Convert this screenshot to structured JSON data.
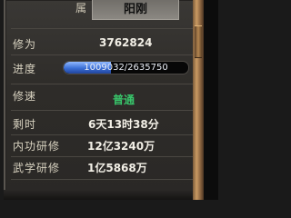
{
  "attribute": {
    "label": "属",
    "value": "阳刚"
  },
  "cultivation": {
    "label": "修为",
    "value": "3762824"
  },
  "progress": {
    "label": "进度",
    "text": "1009032/2635750",
    "current": 1009032,
    "max": 2635750
  },
  "speed": {
    "label": "修速",
    "value": "普通",
    "color": "#38c46a"
  },
  "remaining": {
    "label": "剩时",
    "value": "6天13时38分"
  },
  "inner_study": {
    "label": "内功研修",
    "value": "12亿3240万"
  },
  "martial_study": {
    "label": "武学研修",
    "value": "1亿5868万"
  }
}
